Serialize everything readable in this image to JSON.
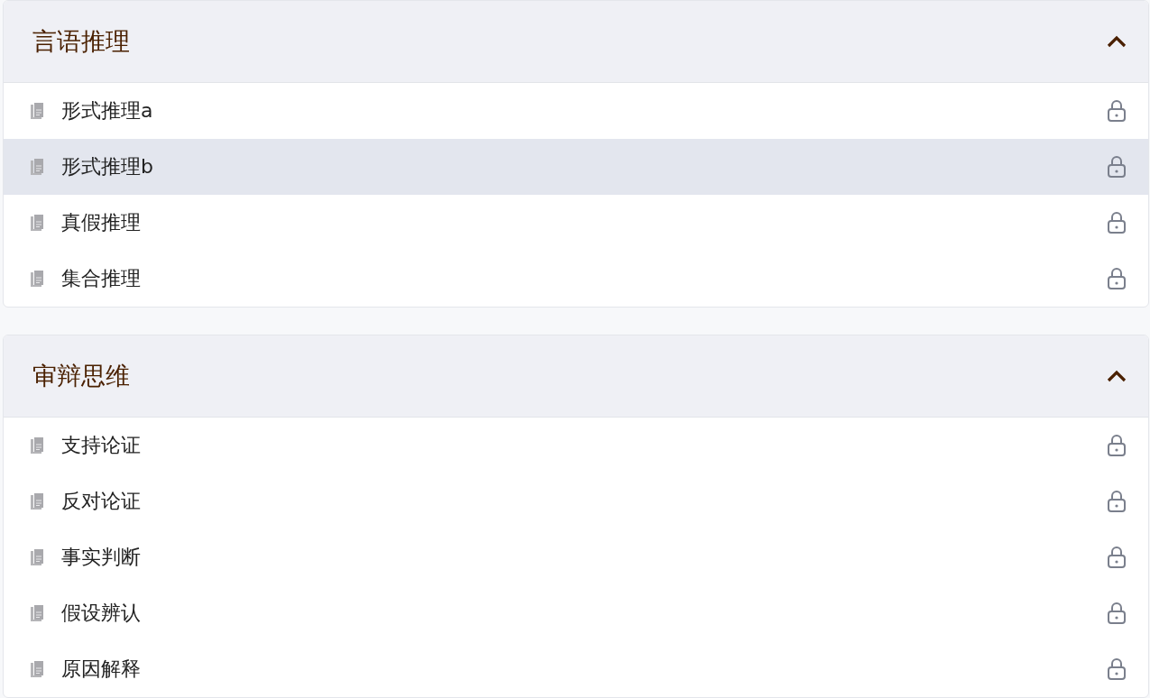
{
  "sections": [
    {
      "title": "言语推理",
      "expanded": true,
      "items": [
        {
          "label": "形式推理a",
          "selected": false,
          "locked": true
        },
        {
          "label": "形式推理b",
          "selected": true,
          "locked": true
        },
        {
          "label": "真假推理",
          "selected": false,
          "locked": true
        },
        {
          "label": "集合推理",
          "selected": false,
          "locked": true
        }
      ]
    },
    {
      "title": "审辩思维",
      "expanded": true,
      "items": [
        {
          "label": "支持论证",
          "selected": false,
          "locked": true
        },
        {
          "label": "反对论证",
          "selected": false,
          "locked": true
        },
        {
          "label": "事实判断",
          "selected": false,
          "locked": true
        },
        {
          "label": "假设辨认",
          "selected": false,
          "locked": true
        },
        {
          "label": "原因解释",
          "selected": false,
          "locked": true
        }
      ]
    }
  ]
}
